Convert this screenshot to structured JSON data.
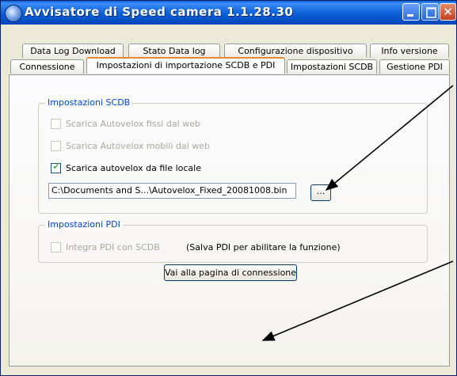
{
  "window": {
    "title": "Avvisatore di Speed camera  1.1.28.30"
  },
  "tabs": {
    "row1": [
      "Data Log Download",
      "Stato Data log",
      "Configurazione dispositivo",
      "Info versione"
    ],
    "row2": [
      "Connessione",
      "Impostazioni di importazione SCDB e PDI",
      "Impostazioni SCDB",
      "Gestione PDI"
    ],
    "active": "Impostazioni di importazione SCDB e PDI"
  },
  "scdb": {
    "group_label": "Impostazioni SCDB",
    "opt_fixed_web": "Scarica Autovelox fissi dal web",
    "opt_mobile_web": "Scarica Autovelox mobili dal web",
    "opt_local_file": "Scarica autovelox da file locale",
    "local_file_checked": true,
    "file_path": "C:\\Documents and S...\\Autovelox_Fixed_20081008.bin",
    "browse_label": "..."
  },
  "pdi": {
    "group_label": "Impostazioni PDI",
    "opt_integrate": "Integra PDI con SCDB",
    "note": "(Salva PDI per abilitare la funzione)"
  },
  "actions": {
    "goto_connection": "Vai alla pagina di connessione"
  },
  "icons": [
    "app-icon",
    "minimize-icon",
    "maximize-icon",
    "close-icon",
    "checkmark-icon",
    "arrow-annotation"
  ]
}
